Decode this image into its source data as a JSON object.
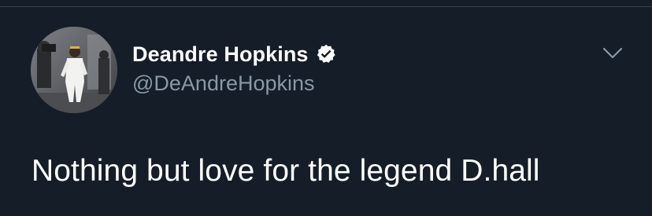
{
  "tweet": {
    "author": {
      "display_name": "Deandre Hopkins",
      "handle": "@DeAndreHopkins",
      "verified": true,
      "avatar": "avatar-photo"
    },
    "text": "Nothing but love for the legend D.hall",
    "menu_icon": "chevron-down-icon"
  },
  "colors": {
    "background": "#151d28",
    "name": "#ffffff",
    "handle": "#8899a6",
    "divider": "#38444d",
    "verified_badge": "#ffffff"
  }
}
